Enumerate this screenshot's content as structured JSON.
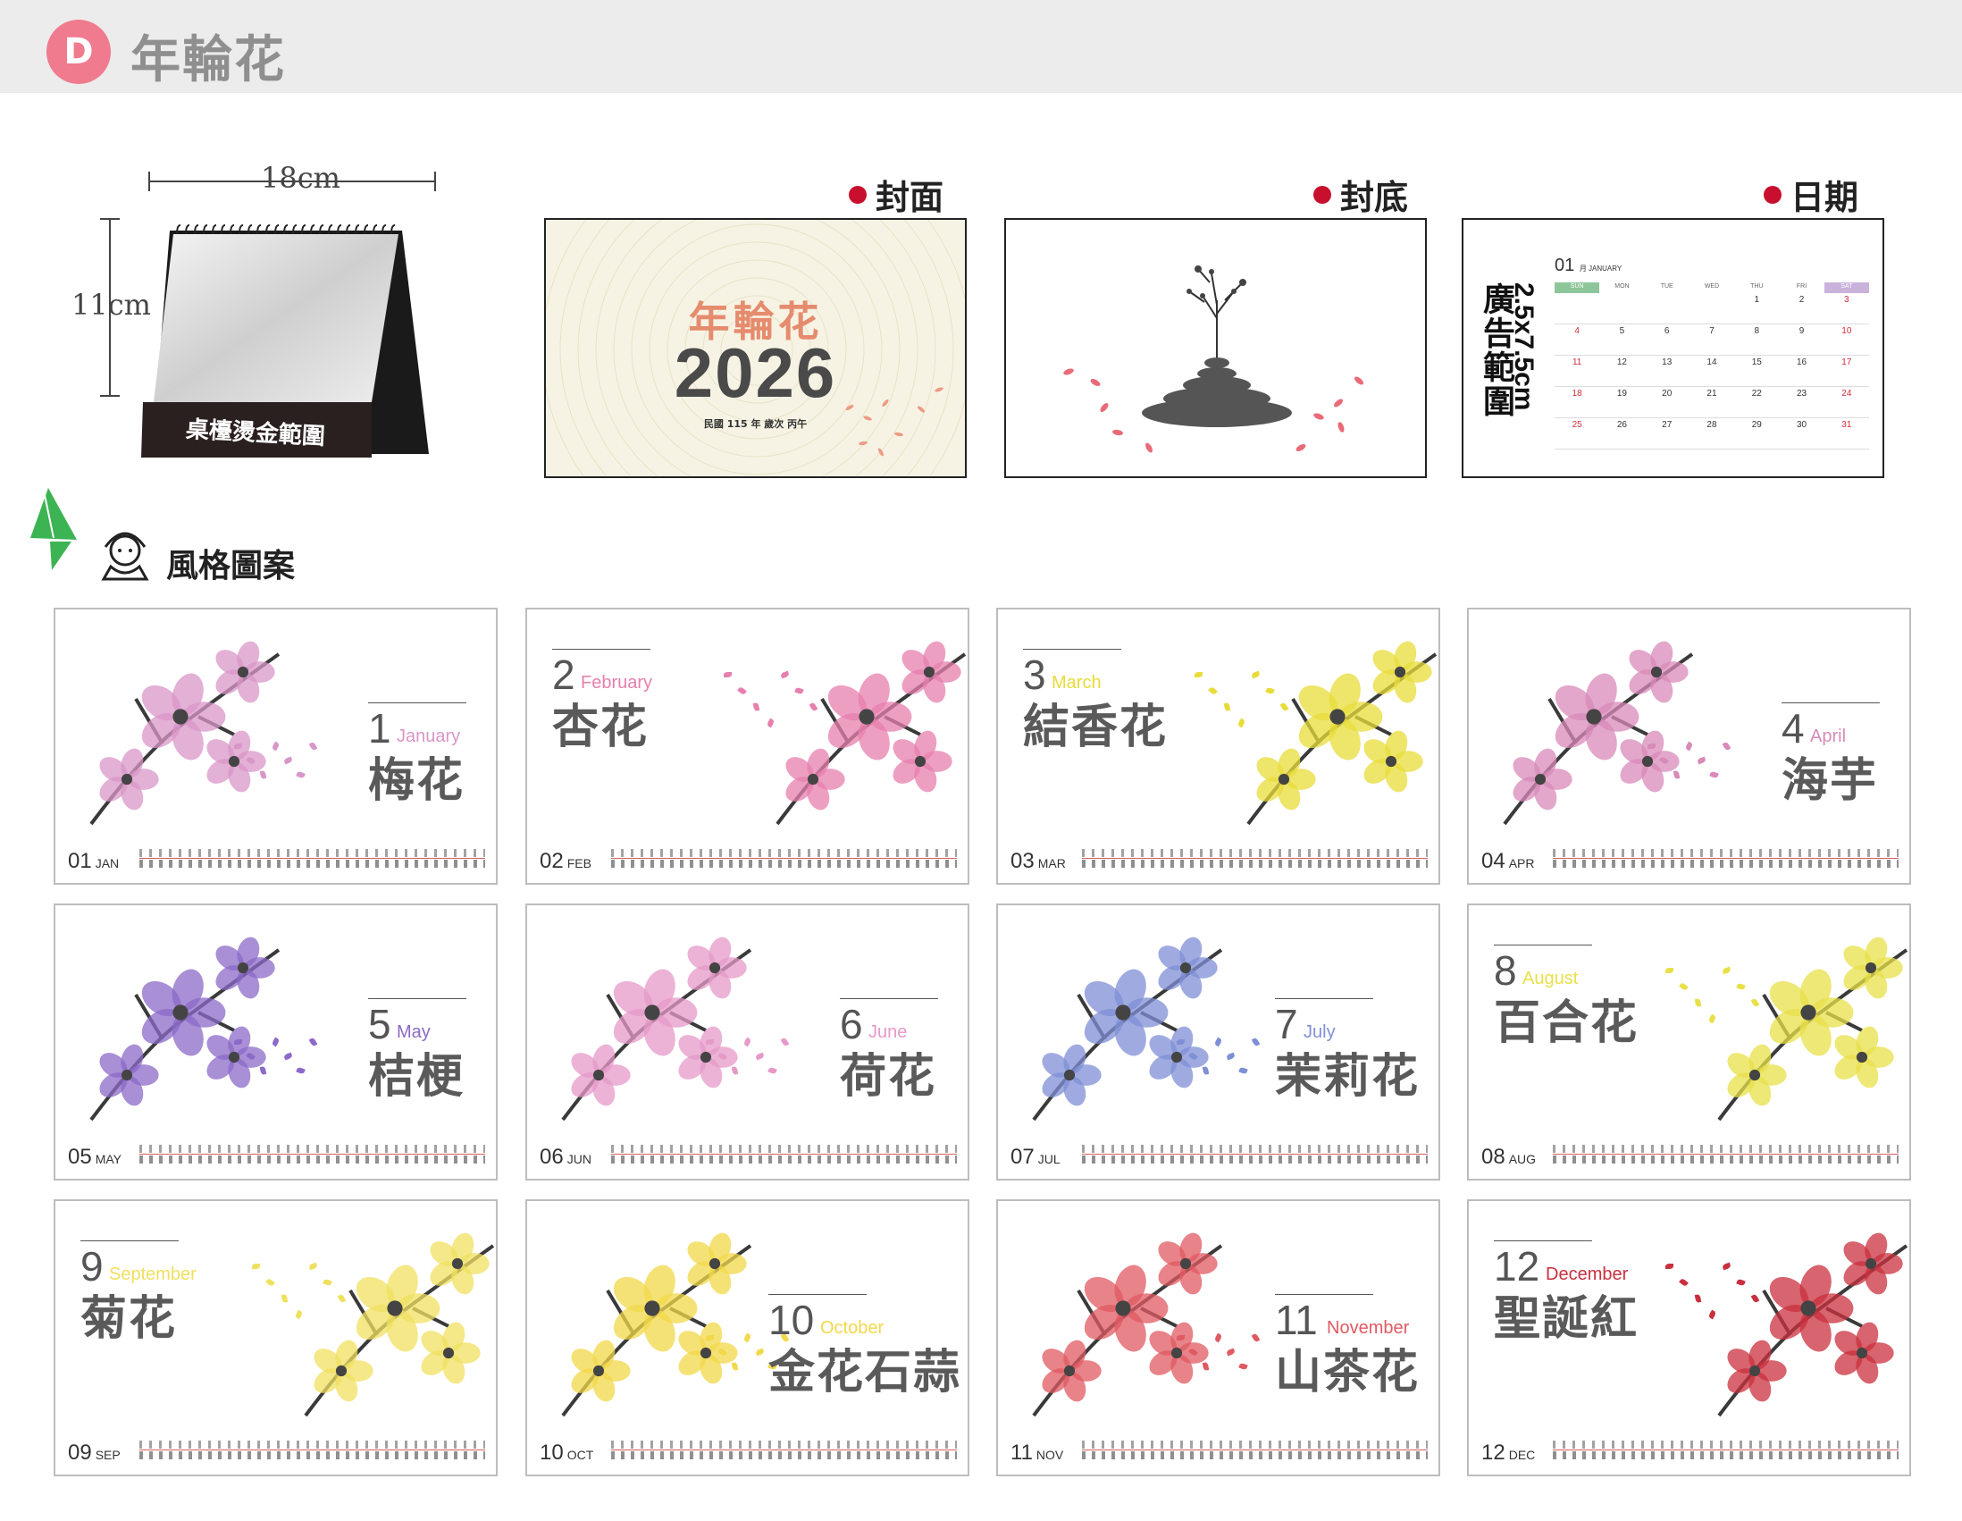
{
  "header": {
    "badge": "D",
    "title": "年輪花"
  },
  "desk": {
    "width_label": "18cm",
    "height_label": "11cm",
    "foil_area": "桌檯燙金範圍"
  },
  "sections": {
    "cover": "封面",
    "back": "封底",
    "date": "日期"
  },
  "cover_page": {
    "title": "年輪花",
    "year": "2026",
    "sub": "民國 115 年  歲次 丙午"
  },
  "date_page": {
    "ad_area": "廣告範圍",
    "ad_size": "2.5x7.5cm",
    "month_num": "01",
    "month_sub": "月 JANUARY",
    "weekdays": [
      "SUN",
      "MON",
      "TUE",
      "WED",
      "THU",
      "FRI",
      "SAT"
    ],
    "weeks": [
      [
        "",
        "",
        "",
        "",
        "1",
        "2",
        "3"
      ],
      [
        "4",
        "5",
        "6",
        "7",
        "8",
        "9",
        "10"
      ],
      [
        "11",
        "12",
        "13",
        "14",
        "15",
        "16",
        "17"
      ],
      [
        "18",
        "19",
        "20",
        "21",
        "22",
        "23",
        "24"
      ],
      [
        "25",
        "26",
        "27",
        "28",
        "29",
        "30",
        "31"
      ]
    ]
  },
  "style_label": "風格圖案",
  "colors": {
    "accent_red": "#c8102e",
    "badge_pink": "#f07a8e",
    "sun_green": "#8ec69b",
    "sat_purple": "#c9b2dc"
  },
  "months": [
    {
      "num": "1",
      "eng": "January",
      "name": "梅花",
      "foot": "01",
      "abbr": "JAN",
      "color": "#d996c8"
    },
    {
      "num": "2",
      "eng": "February",
      "name": "杏花",
      "foot": "02",
      "abbr": "FEB",
      "color": "#e77fae"
    },
    {
      "num": "3",
      "eng": "March",
      "name": "結香花",
      "foot": "03",
      "abbr": "MAR",
      "color": "#e8dc3a"
    },
    {
      "num": "4",
      "eng": "April",
      "name": "海芋",
      "foot": "04",
      "abbr": "APR",
      "color": "#d88ab8"
    },
    {
      "num": "5",
      "eng": "May",
      "name": "桔梗",
      "foot": "05",
      "abbr": "MAY",
      "color": "#8b6ac8"
    },
    {
      "num": "6",
      "eng": "June",
      "name": "荷花",
      "foot": "06",
      "abbr": "JUN",
      "color": "#e59ac8"
    },
    {
      "num": "7",
      "eng": "July",
      "name": "茉莉花",
      "foot": "07",
      "abbr": "JUL",
      "color": "#7f8fd6"
    },
    {
      "num": "8",
      "eng": "August",
      "name": "百合花",
      "foot": "08",
      "abbr": "AUG",
      "color": "#e8e04a"
    },
    {
      "num": "9",
      "eng": "September",
      "name": "菊花",
      "foot": "09",
      "abbr": "SEP",
      "color": "#f0e060"
    },
    {
      "num": "10",
      "eng": "October",
      "name": "金花石蒜",
      "foot": "10",
      "abbr": "OCT",
      "color": "#f2d84a"
    },
    {
      "num": "11",
      "eng": "November",
      "name": "山茶花",
      "foot": "11",
      "abbr": "NOV",
      "color": "#e05a62"
    },
    {
      "num": "12",
      "eng": "December",
      "name": "聖誕紅",
      "foot": "12",
      "abbr": "DEC",
      "color": "#c9303e"
    }
  ]
}
